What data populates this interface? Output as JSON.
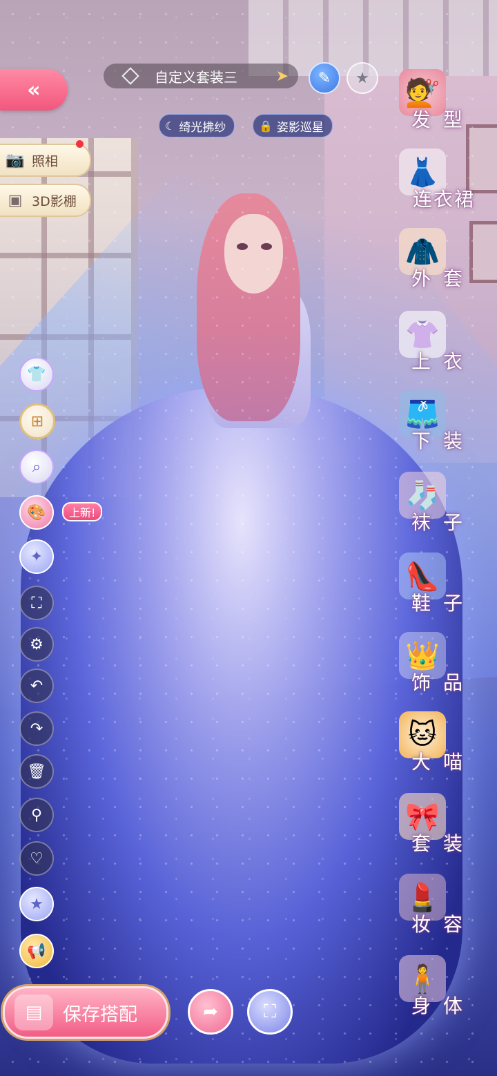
{
  "topbar": {
    "back_icon": "double-chevron-left-icon",
    "suit_name": "自定义套装三",
    "edit_icon": "pencil-icon",
    "favorite_icon": "star-icon"
  },
  "tags": [
    {
      "icon": "moon-icon",
      "label": "绮光拂纱"
    },
    {
      "icon": "lock-icon",
      "label": "姿影巡星"
    }
  ],
  "left_pills": {
    "photo": "照相",
    "studio": "3D影棚"
  },
  "left_tools": {
    "new_badge": "上新!",
    "icons": [
      "outfit-icon",
      "add-layer-icon",
      "search-compare-icon",
      "palette-icon",
      "star-sparkle-icon",
      "fullscreen-icon",
      "gear-icon",
      "undo-icon",
      "redo-icon",
      "trash-icon",
      "zoom-icon",
      "heart-icon",
      "star-badge-icon",
      "megaphone-icon"
    ]
  },
  "categories": [
    {
      "label": "发型",
      "icon": "hairstyle-icon"
    },
    {
      "label": "连衣裙",
      "icon": "dress-icon"
    },
    {
      "label": "外套",
      "icon": "coat-icon"
    },
    {
      "label": "上衣",
      "icon": "top-icon"
    },
    {
      "label": "下装",
      "icon": "bottom-icon"
    },
    {
      "label": "袜子",
      "icon": "sock-icon"
    },
    {
      "label": "鞋子",
      "icon": "shoe-icon"
    },
    {
      "label": "饰品",
      "icon": "tiara-icon"
    },
    {
      "label": "大喵",
      "icon": "cat-icon"
    },
    {
      "label": "套装",
      "icon": "suit-icon"
    },
    {
      "label": "妆容",
      "icon": "makeup-icon"
    },
    {
      "label": "身体",
      "icon": "body-icon"
    }
  ],
  "bottom": {
    "save_label": "保存搭配",
    "save_icon": "wardrobe-icon",
    "share_icon": "share-icon",
    "outfit_icon": "outfit-frame-icon"
  },
  "colors": {
    "primary_pink": "#f25d86",
    "accent_gold": "#e1c07a",
    "tag_blue": "#283278"
  }
}
